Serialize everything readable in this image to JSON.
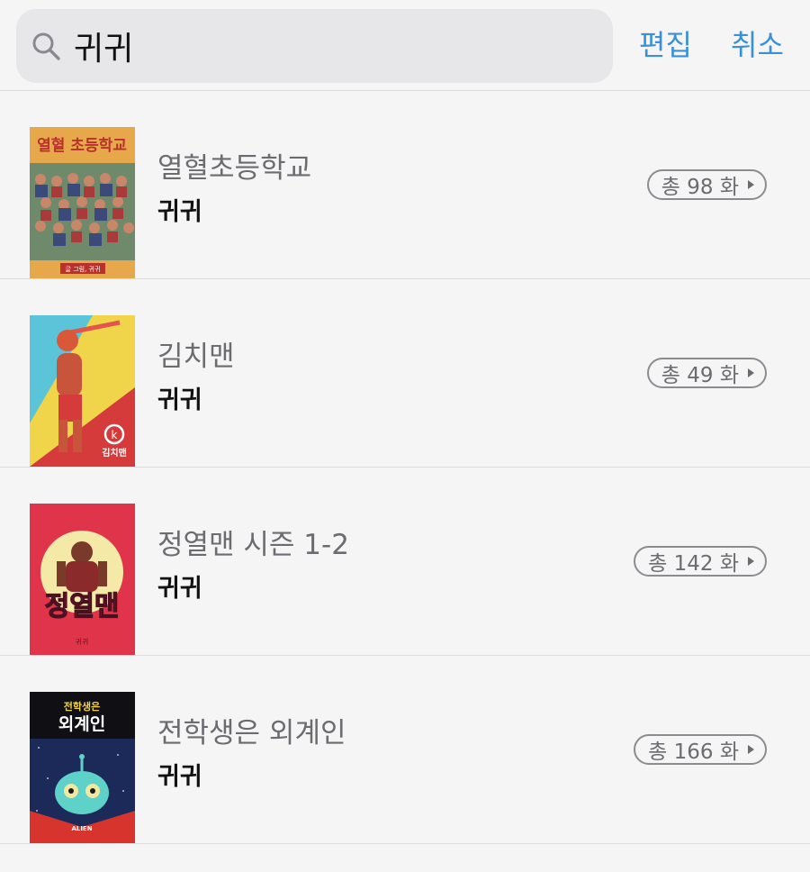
{
  "search": {
    "query": "귀귀"
  },
  "header": {
    "edit_label": "편집",
    "cancel_label": "취소"
  },
  "results": [
    {
      "title": "열혈초등학교",
      "author": "귀귀",
      "count_label": "총 98 화",
      "cover_text": "열혈 초등학교",
      "cover_footer": "글 그림, 귀귀"
    },
    {
      "title": "김치맨",
      "author": "귀귀",
      "count_label": "총 49 화",
      "cover_text": "김치맨"
    },
    {
      "title": "정열맨 시즌 1-2",
      "author": "귀귀",
      "count_label": "총 142 화",
      "cover_text": "정열맨",
      "cover_footer": "귀귀"
    },
    {
      "title": "전학생은 외계인",
      "author": "귀귀",
      "count_label": "총 166 화",
      "cover_text": "전학생은 외계인",
      "cover_footer": "ALIEN"
    }
  ],
  "colors": {
    "accent": "#3a8fd9",
    "background": "#f5f5f6"
  }
}
